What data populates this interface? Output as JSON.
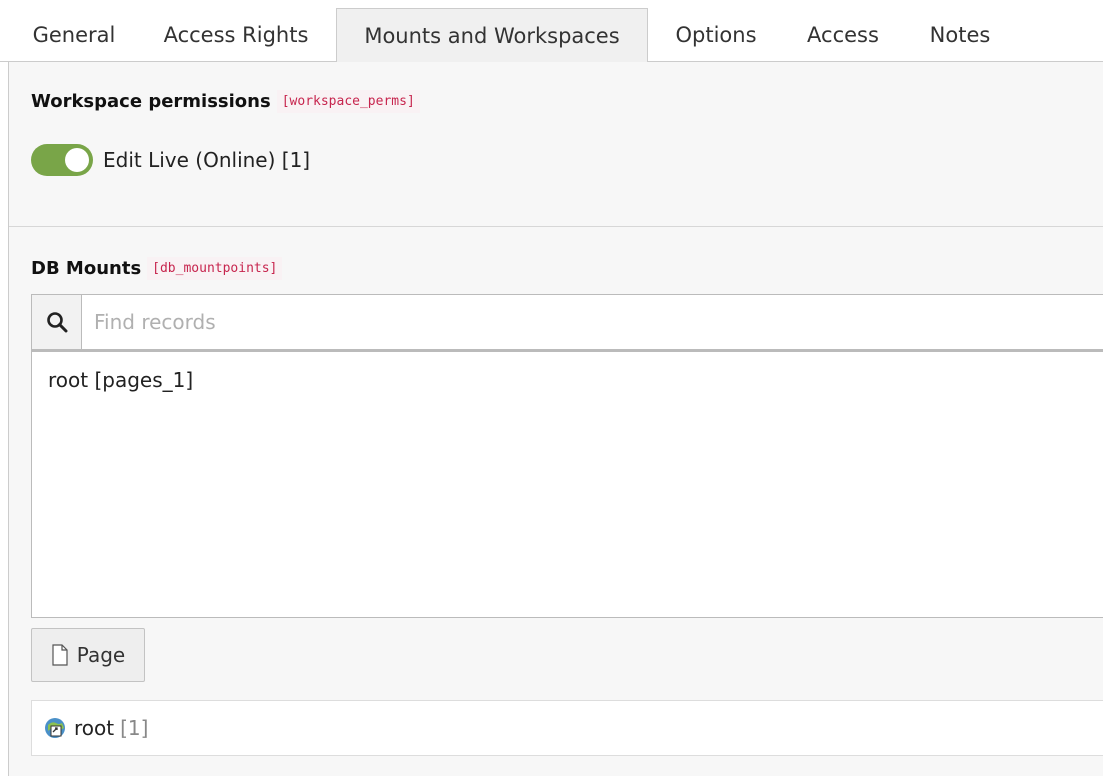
{
  "tabs": [
    {
      "label": "General"
    },
    {
      "label": "Access Rights"
    },
    {
      "label": "Mounts and Workspaces"
    },
    {
      "label": "Options"
    },
    {
      "label": "Access"
    },
    {
      "label": "Notes"
    }
  ],
  "active_tab": "Mounts and Workspaces",
  "workspace_permissions": {
    "label": "Workspace permissions",
    "field_code": "[workspace_perms]",
    "toggle_label": "Edit Live (Online) [1]",
    "toggle_on": true
  },
  "db_mounts": {
    "label": "DB Mounts",
    "field_code": "[db_mountpoints]",
    "search_placeholder": "Find records",
    "selected_items": [
      "root [pages_1]"
    ],
    "page_button_label": "Page",
    "record": {
      "title": "root",
      "uid": "[1]"
    }
  },
  "colors": {
    "toggle_on": "#79a548",
    "field_code": "#c7254e",
    "active_tab_bg": "#f0f0f0"
  },
  "icons": {
    "search": "search-icon",
    "page_button": "document-icon",
    "record": "page-root-icon"
  }
}
